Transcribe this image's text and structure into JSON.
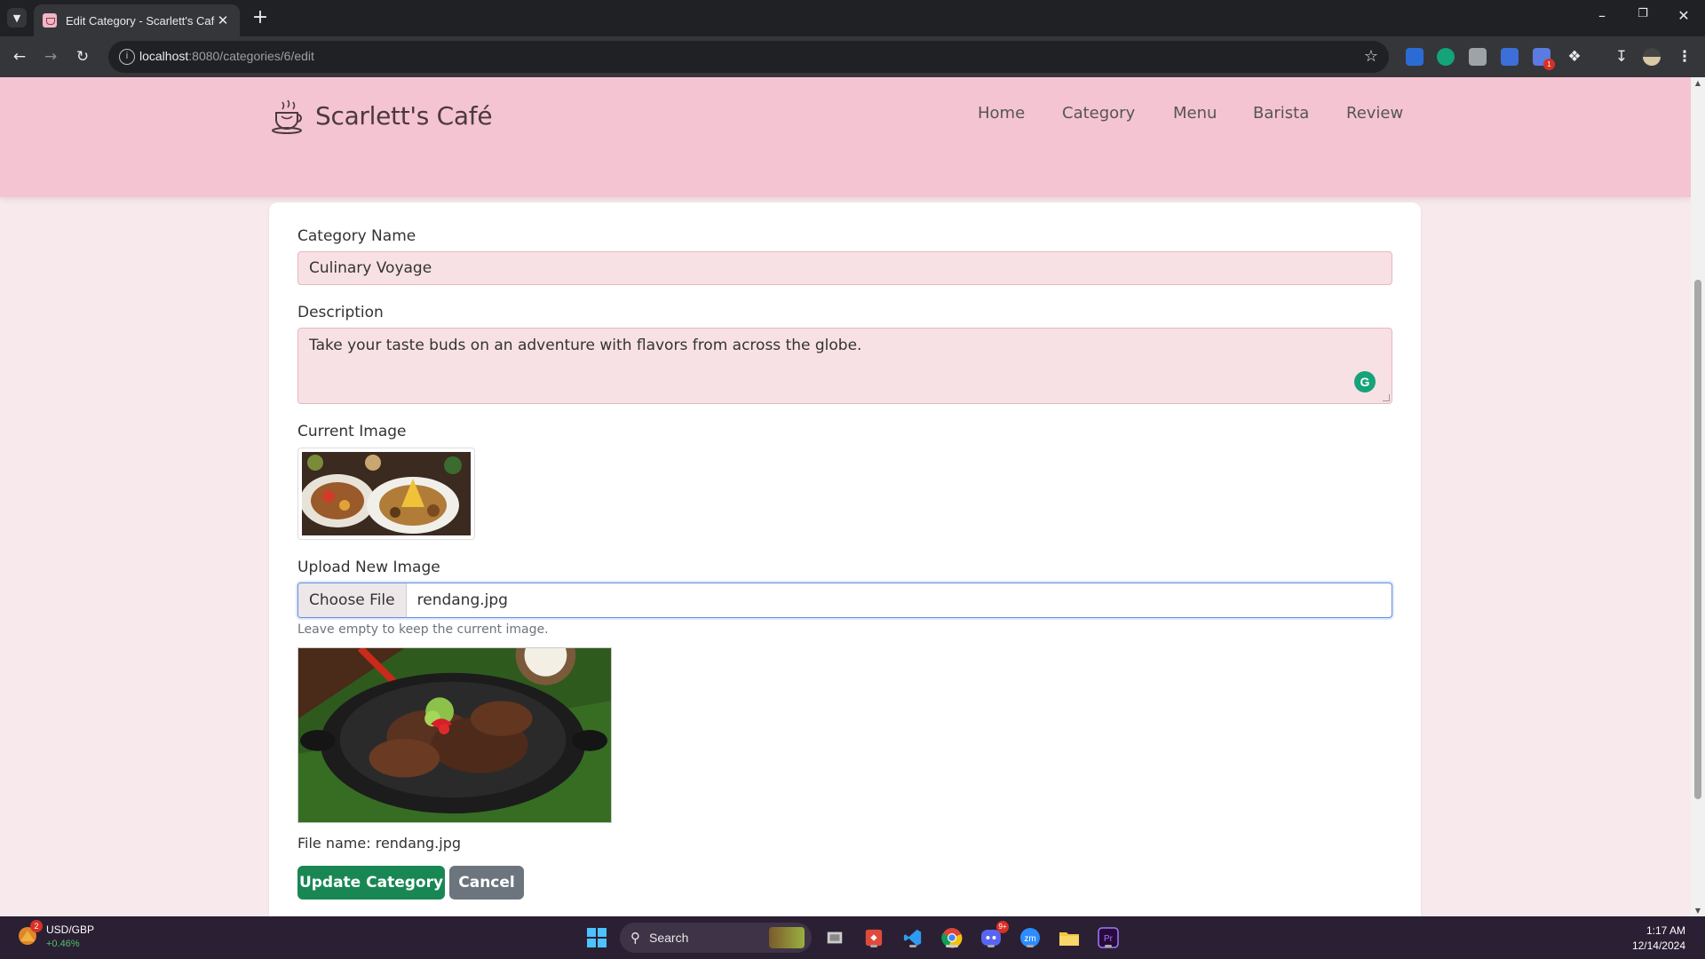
{
  "browser": {
    "tab_title": "Edit Category - Scarlett's Cafe",
    "url_host": "localhost",
    "url_path": ":8080/categories/6/edit",
    "extension_badge": "1"
  },
  "site": {
    "brand": "Scarlett's Café",
    "nav": [
      "Home",
      "Category",
      "Menu",
      "Barista",
      "Review"
    ]
  },
  "form": {
    "name_label": "Category Name",
    "name_value": "Culinary Voyage",
    "description_label": "Description",
    "description_value": "Take your taste buds on an adventure with flavors from across the globe.",
    "current_image_label": "Current Image",
    "upload_label": "Upload New Image",
    "choose_file": "Choose File",
    "file_value": "rendang.jpg",
    "help_text": "Leave empty to keep the current image.",
    "file_name_caption": "File name: rendang.jpg",
    "update_button": "Update Category",
    "cancel_button": "Cancel"
  },
  "taskbar": {
    "ticker_badge": "2",
    "ticker_name": "USD/GBP",
    "ticker_change": "+0.46%",
    "search_placeholder": "Search",
    "discord_badge": "9+",
    "time": "1:17 AM",
    "date": "12/14/2024"
  },
  "colors": {
    "header": "#f5c4d3",
    "page_bg": "#f8e9ec",
    "field_bg": "#f8e1e4",
    "primary": "#198754",
    "secondary": "#6c757d"
  },
  "icons": [
    "tab-search-icon",
    "back-icon",
    "forward-icon",
    "reload-icon",
    "site-info-icon",
    "bookmark-star-icon",
    "grammarly-icon",
    "download-icon",
    "profile-icon",
    "menu-icon",
    "windows-start-icon",
    "search-icon",
    "coffee-cup-icon"
  ]
}
